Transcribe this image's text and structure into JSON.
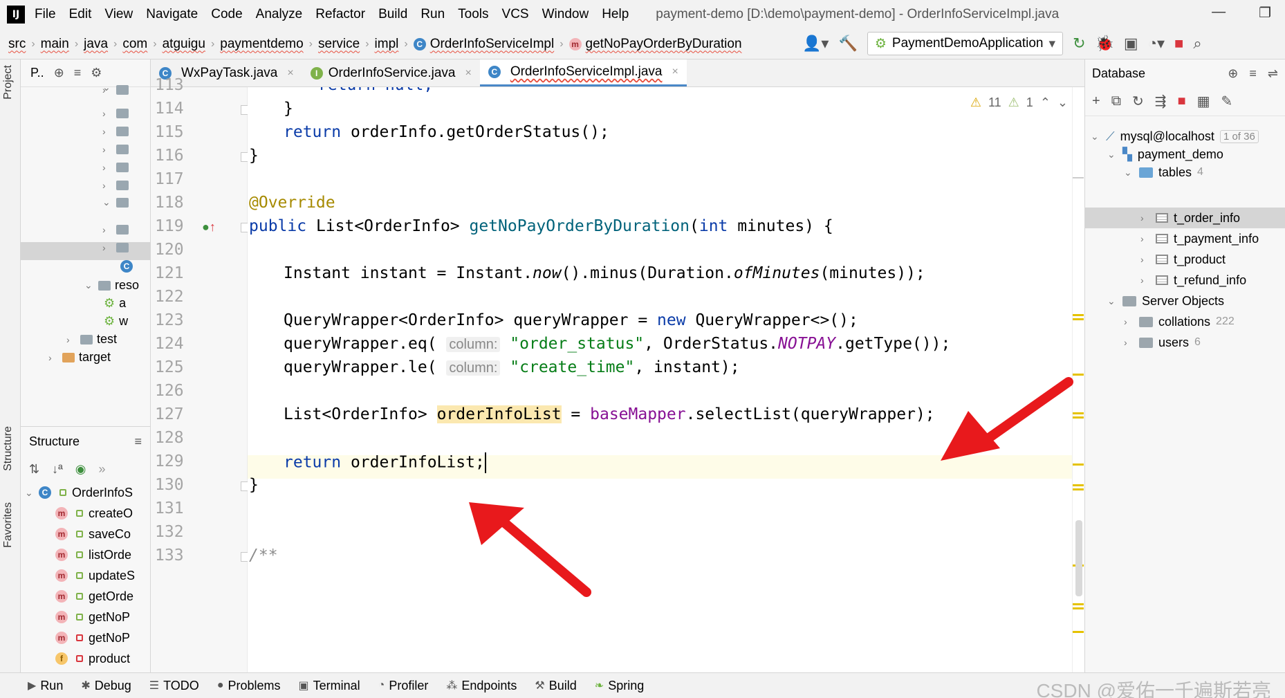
{
  "menubar": {
    "logo": "IJ",
    "items": [
      "File",
      "Edit",
      "View",
      "Navigate",
      "Code",
      "Analyze",
      "Refactor",
      "Build",
      "Run",
      "Tools",
      "VCS",
      "Window",
      "Help"
    ],
    "window_title": "payment-demo [D:\\demo\\payment-demo] - OrderInfoServiceImpl.java"
  },
  "navbar": {
    "crumbs": [
      "src",
      "main",
      "java",
      "com",
      "atguigu",
      "paymentdemo",
      "service",
      "impl"
    ],
    "class_crumb": "OrderInfoServiceImpl",
    "method_crumb": "getNoPayOrderByDuration",
    "run_config": "PaymentDemoApplication"
  },
  "left_strip": {
    "project_tab": "Project",
    "structure_tab": "Structure",
    "favorites_tab": "Favorites"
  },
  "project_panel": {
    "title": "P..",
    "rows": [
      {
        "label": "reso"
      },
      {
        "label": "a"
      },
      {
        "label": "w"
      },
      {
        "label": "test"
      },
      {
        "label": "target"
      }
    ]
  },
  "structure_panel": {
    "title": "Structure",
    "root": "OrderInfoS",
    "members": [
      {
        "kind": "m",
        "label": "createO"
      },
      {
        "kind": "m",
        "label": "saveCo"
      },
      {
        "kind": "m",
        "label": "listOrde"
      },
      {
        "kind": "m",
        "label": "updateS"
      },
      {
        "kind": "m",
        "label": "getOrde"
      },
      {
        "kind": "m",
        "label": "getNoP"
      },
      {
        "kind": "m",
        "label": "getNoP"
      },
      {
        "kind": "f",
        "label": "product"
      }
    ]
  },
  "editor_tabs": [
    {
      "label": "WxPayTask.java",
      "icon": "C",
      "active": false
    },
    {
      "label": "OrderInfoService.java",
      "icon": "I",
      "active": false
    },
    {
      "label": "OrderInfoServiceImpl.java",
      "icon": "C",
      "active": true
    }
  ],
  "inspection": {
    "warnings": "11",
    "weak_warnings": "1"
  },
  "line_numbers": [
    "113",
    "114",
    "115",
    "116",
    "117",
    "118",
    "119",
    "120",
    "121",
    "122",
    "123",
    "124",
    "125",
    "126",
    "127",
    "128",
    "129",
    "130",
    "131",
    "132",
    "133"
  ],
  "code": {
    "l113": "return null;",
    "l114": "}",
    "l115_a": "return ",
    "l115_b": "orderInfo.getOrderStatus();",
    "l116": "}",
    "l118": "@Override",
    "l119_kw": "public ",
    "l119_type": "List<OrderInfo> ",
    "l119_fn": "getNoPayOrderByDuration",
    "l119_params_kw": "int",
    "l119_rest": " minutes) {",
    "l121_a": "Instant instant = Instant.",
    "l121_now": "now",
    "l121_b": "().minus(Duration.",
    "l121_of": "ofMinutes",
    "l121_c": "(minutes));",
    "l123_a": "QueryWrapper<OrderInfo> queryWrapper = ",
    "l123_new": "new",
    "l123_b": " QueryWrapper<>();",
    "l124_a": "queryWrapper.eq( ",
    "hint_column": "column:",
    "l124_str": "\"order_status\"",
    "l124_b": ", OrderStatus.",
    "l124_enum": "NOTPAY",
    "l124_c": ".getType());",
    "l125_a": "queryWrapper.le( ",
    "l125_str": "\"create_time\"",
    "l125_b": ", instant);",
    "l127_a": "List<OrderInfo> ",
    "l127_var": "orderInfoList",
    "l127_b": " = ",
    "l127_field": "baseMapper",
    "l127_c": ".selectList(queryWrapper);",
    "l129_kw": "return ",
    "l129_b": "orderInfoList;",
    "l130": "}",
    "l132": "/**"
  },
  "database_panel": {
    "title": "Database",
    "connection": "mysql@localhost",
    "connection_badge": "1 of 36",
    "schema": "payment_demo",
    "tables_label": "tables",
    "tables_count": "4",
    "tables": [
      "t_order_info",
      "t_payment_info",
      "t_product",
      "t_refund_info"
    ],
    "server_objects": "Server Objects",
    "collations": "collations",
    "collations_count": "222",
    "users": "users",
    "users_count": "6"
  },
  "bottombar": {
    "tools": [
      "Run",
      "Debug",
      "TODO",
      "Problems",
      "Terminal",
      "Profiler",
      "Endpoints",
      "Build",
      "Spring"
    ],
    "watermark": "CSDN @爱佑一千遍斯若亮"
  },
  "colors": {
    "keyword": "#0a3ba8",
    "annotation": "#a68a00",
    "method": "#00627a",
    "field": "#871094",
    "string": "#067d17",
    "arrow": "#e8191c"
  }
}
